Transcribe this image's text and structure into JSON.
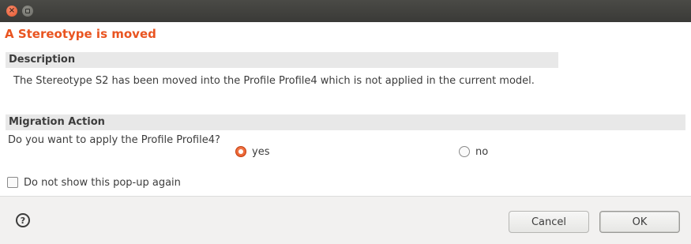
{
  "window": {
    "controls": {
      "close_icon": "close-icon",
      "minimize_icon": "minimize-icon"
    }
  },
  "dialog": {
    "title": "A Stereotype is moved",
    "description": {
      "header": "Description",
      "text": "The Stereotype S2 has been moved into the Profile Profile4 which is not applied in the current model."
    },
    "migration": {
      "header": "Migration Action",
      "question": "Do you want to apply the Profile Profile4?",
      "options": [
        {
          "label": "yes",
          "selected": true
        },
        {
          "label": "no",
          "selected": false
        }
      ]
    },
    "dont_show": {
      "label": "Do not show this pop-up again",
      "checked": false
    }
  },
  "footer": {
    "help_icon": "help-icon",
    "cancel_label": "Cancel",
    "ok_label": "OK"
  },
  "colors": {
    "title": "#e95420",
    "accent": "#e95420",
    "section_bg": "#e8e8e8",
    "titlebar": "#3c3b37"
  }
}
